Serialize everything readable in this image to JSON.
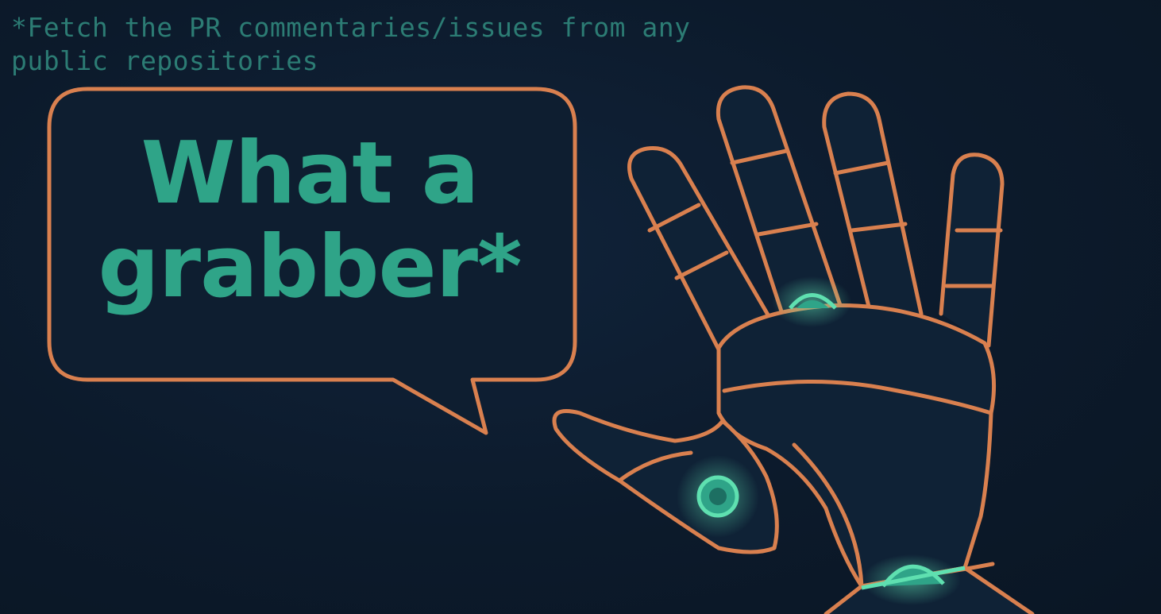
{
  "header": {
    "note": "*Fetch the PR commentaries/issues from any public repositories"
  },
  "bubble": {
    "line1": "What a",
    "line2": "grabber*"
  },
  "illustration": {
    "subject": "robotic-hand-icon"
  },
  "colors": {
    "background": "#0d1b2a",
    "outline": "#d9804f",
    "accent": "#2fa488",
    "note_text": "#2c7c74",
    "glow": "#5fe0b0"
  }
}
